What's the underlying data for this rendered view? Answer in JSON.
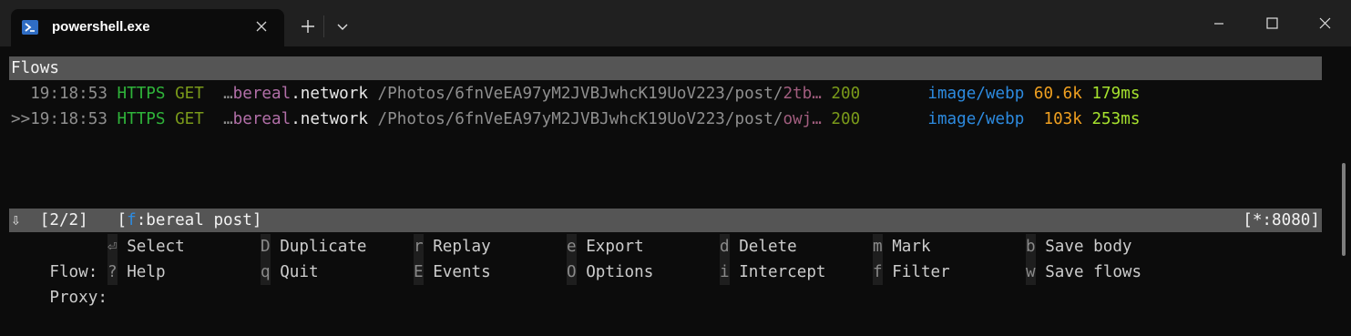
{
  "window": {
    "tab_title": "powershell.exe",
    "new_tab": "+",
    "colors": {
      "titlebar": "#202020",
      "terminal_bg": "#0c0c0c",
      "accent": "#2f6dc4"
    }
  },
  "flows": {
    "header": "Flows",
    "rows": [
      {
        "marker": "  ",
        "time": "19:18:53",
        "scheme": "HTTPS",
        "method": "GET",
        "host_prefix": "…",
        "host_sub": "bereal",
        "host_rest": ".network",
        "path": " /Photos/6fnVeEA97yM2JVBJwhcK19UoV223/post/",
        "path_tail": "2tb…",
        "status": "200",
        "content_type": "image/webp",
        "size": "60.6k",
        "duration": "179ms"
      },
      {
        "marker": ">>",
        "time": "19:18:53",
        "scheme": "HTTPS",
        "method": "GET",
        "host_prefix": "…",
        "host_sub": "bereal",
        "host_rest": ".network",
        "path": " /Photos/6fnVeEA97yM2JVBJwhcK19UoV223/post/",
        "path_tail": "owj…",
        "status": "200",
        "content_type": "image/webp",
        "size": " 103k",
        "duration": "253ms"
      }
    ]
  },
  "statusbar": {
    "arrow": "⇩",
    "count": "[2/2]",
    "filter_open": "[",
    "filter_key": "f",
    "filter_text": ":bereal post]",
    "listen": "[*:8080]"
  },
  "keybindings": {
    "flow_label": "Flow:",
    "proxy_label": "Proxy:",
    "flow": [
      {
        "key": "⏎",
        "label": "Select"
      },
      {
        "key": "D",
        "label": "Duplicate"
      },
      {
        "key": "r",
        "label": "Replay"
      },
      {
        "key": "e",
        "label": "Export"
      },
      {
        "key": "d",
        "label": "Delete"
      },
      {
        "key": "m",
        "label": "Mark"
      },
      {
        "key": "b",
        "label": "Save body"
      }
    ],
    "proxy": [
      {
        "key": "?",
        "label": "Help"
      },
      {
        "key": "q",
        "label": "Quit"
      },
      {
        "key": "E",
        "label": "Events"
      },
      {
        "key": "O",
        "label": "Options"
      },
      {
        "key": "i",
        "label": "Intercept"
      },
      {
        "key": "f",
        "label": "Filter"
      },
      {
        "key": "w",
        "label": "Save flows"
      }
    ]
  }
}
